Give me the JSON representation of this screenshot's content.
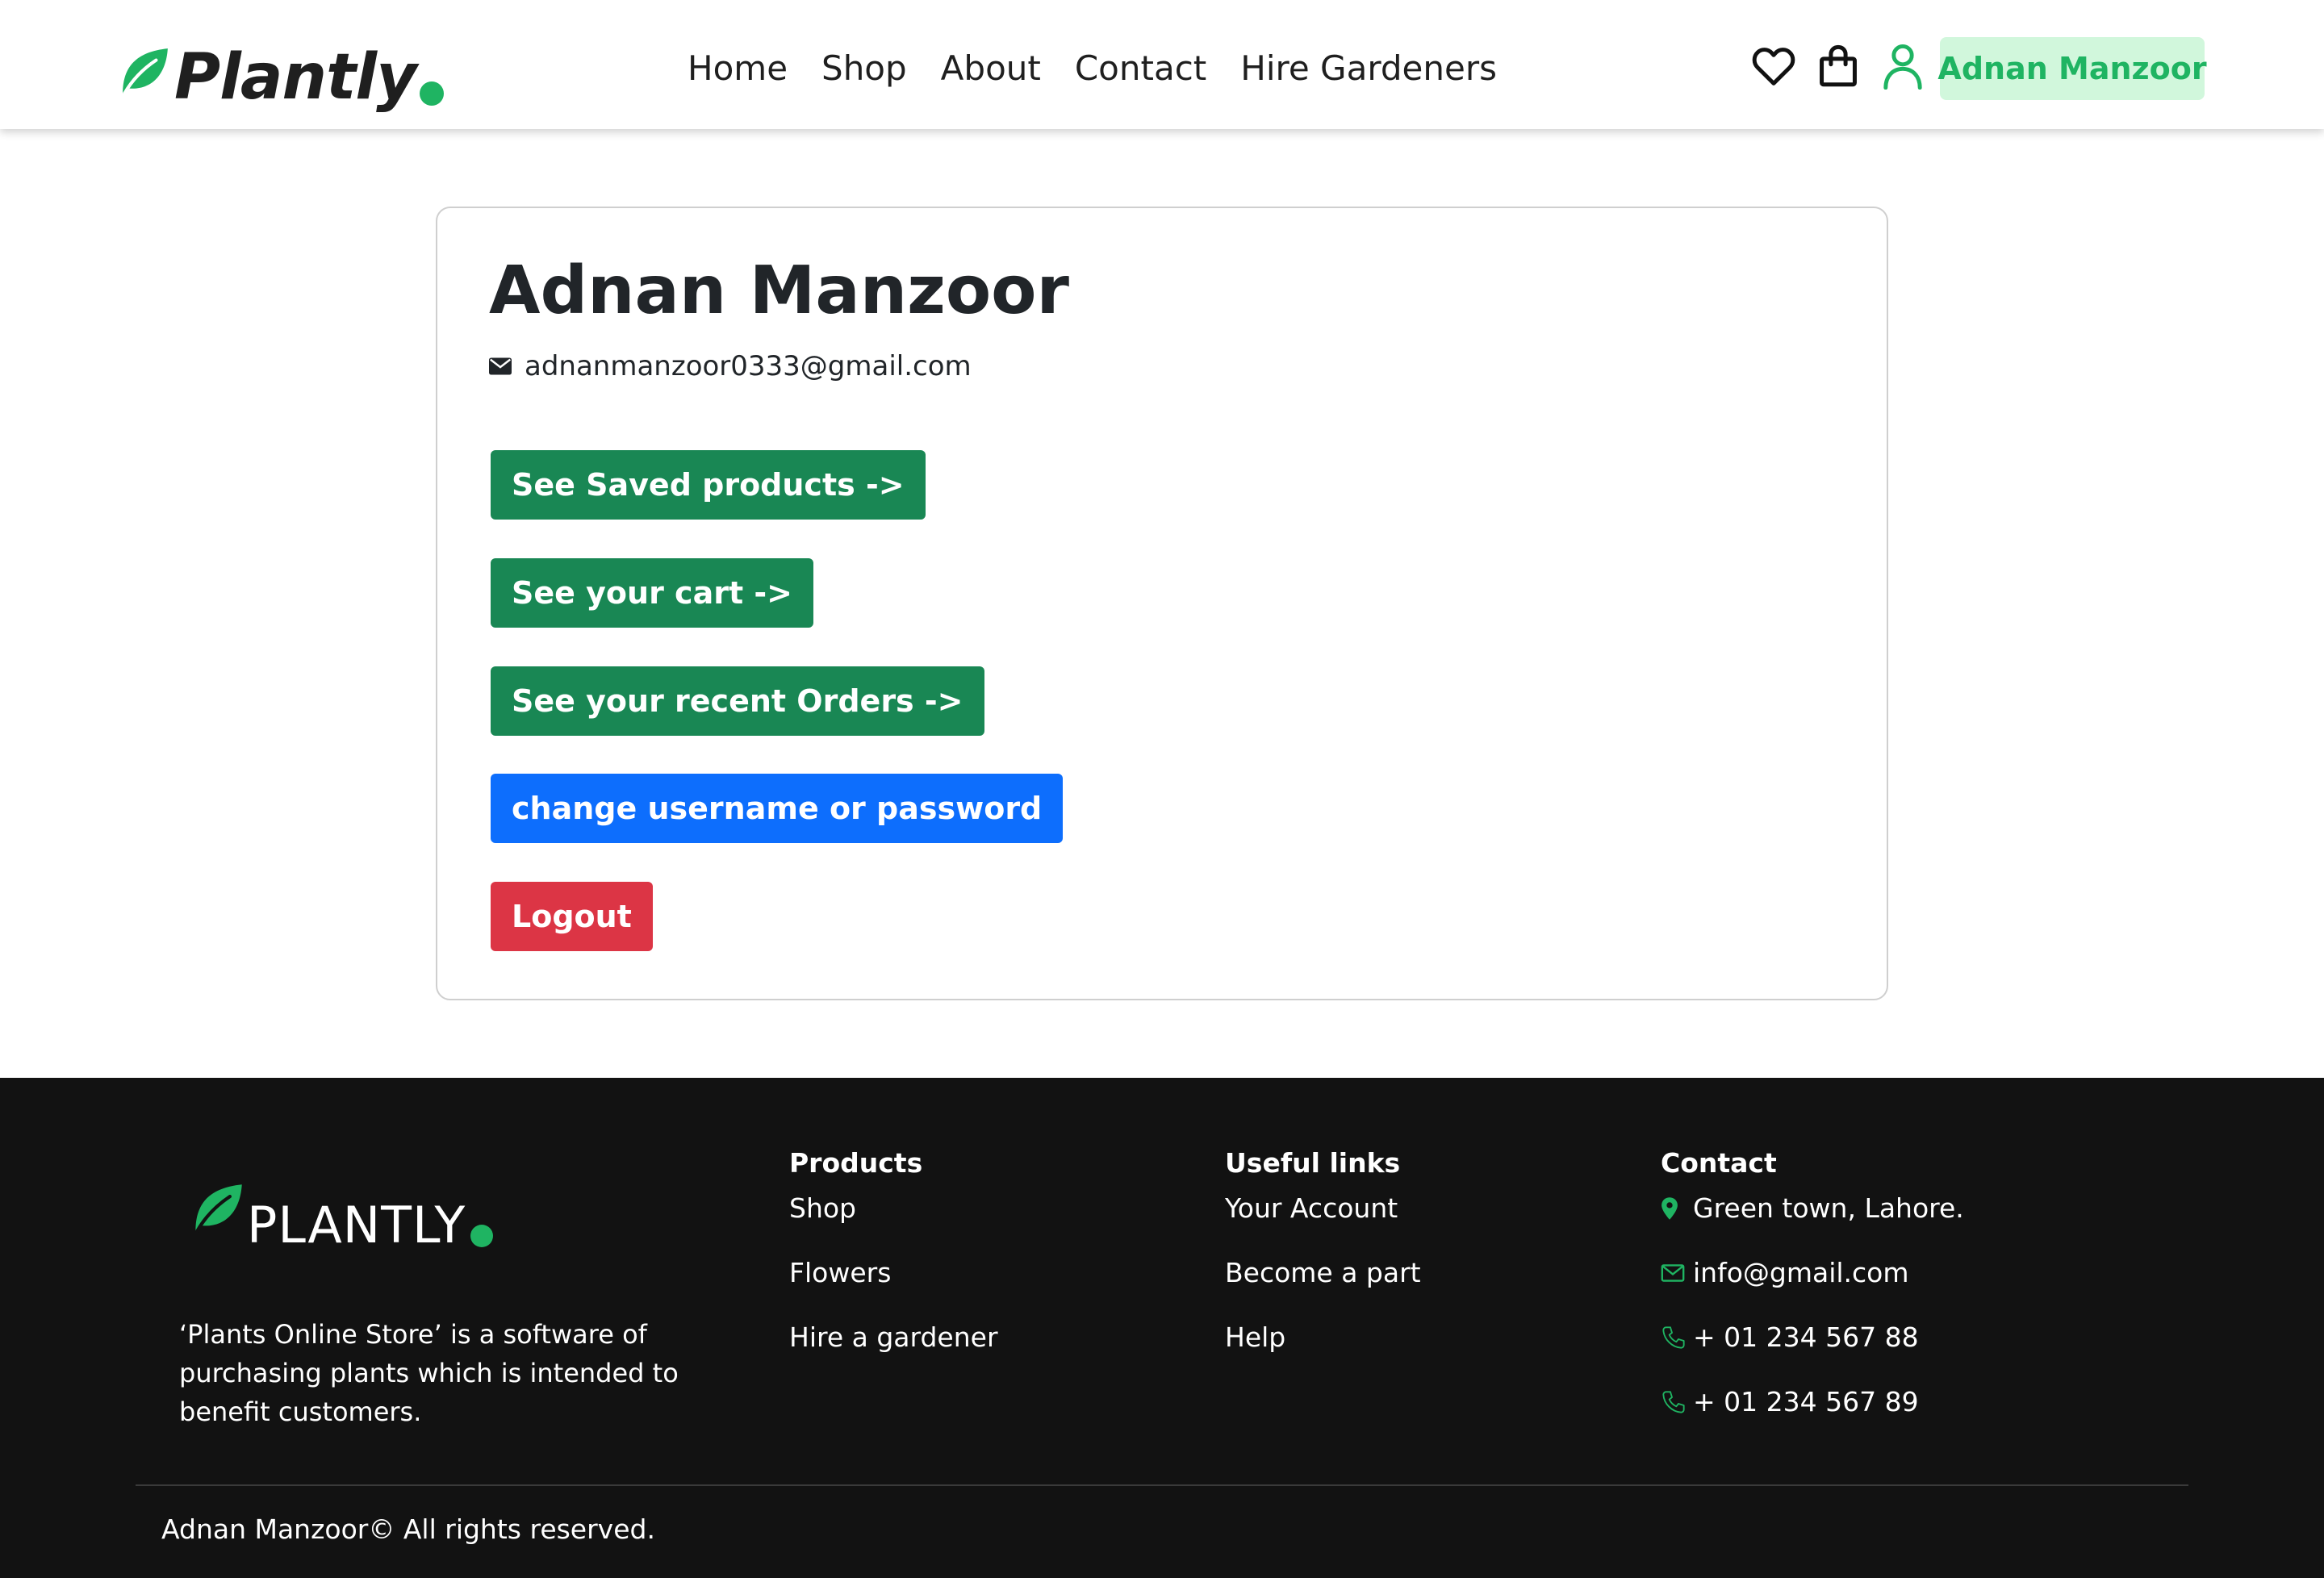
{
  "header": {
    "brand": "Plantly",
    "nav": [
      "Home",
      "Shop",
      "About",
      "Contact",
      "Hire Gardeners"
    ],
    "icons": [
      "heart-icon",
      "shopping-bag-icon",
      "user-icon"
    ],
    "user_name": "Adnan Manzoor"
  },
  "profile": {
    "name": "Adnan Manzoor",
    "email": "adnanmanzoor0333@gmail.com",
    "buttons": {
      "saved": "See Saved products ->",
      "cart": "See your cart ->",
      "orders": "See your recent Orders ->",
      "change": "change username or password",
      "logout": "Logout"
    }
  },
  "footer": {
    "brand": "PLANTLY",
    "description": "‘Plants Online Store’ is a software of purchasing plants which is intended to benefit customers.",
    "products": {
      "title": "Products",
      "items": [
        "Shop",
        "Flowers",
        "Hire a gardener"
      ]
    },
    "useful_links": {
      "title": "Useful links",
      "items": [
        "Your Account",
        "Become a part",
        "Help"
      ]
    },
    "contact": {
      "title": "Contact",
      "address": "Green town, Lahore.",
      "email": "info@gmail.com",
      "phone1": "+ 01 234 567 88",
      "phone2": "+ 01 234 567 89"
    },
    "copyright": "Adnan Manzoor© All rights reserved."
  },
  "colors": {
    "brand_green": "#1fb462",
    "button_green": "#198754",
    "button_blue": "#0d6efd",
    "button_red": "#dc3545",
    "user_pill_bg": "#d1f7dc",
    "footer_bg": "#121212"
  }
}
